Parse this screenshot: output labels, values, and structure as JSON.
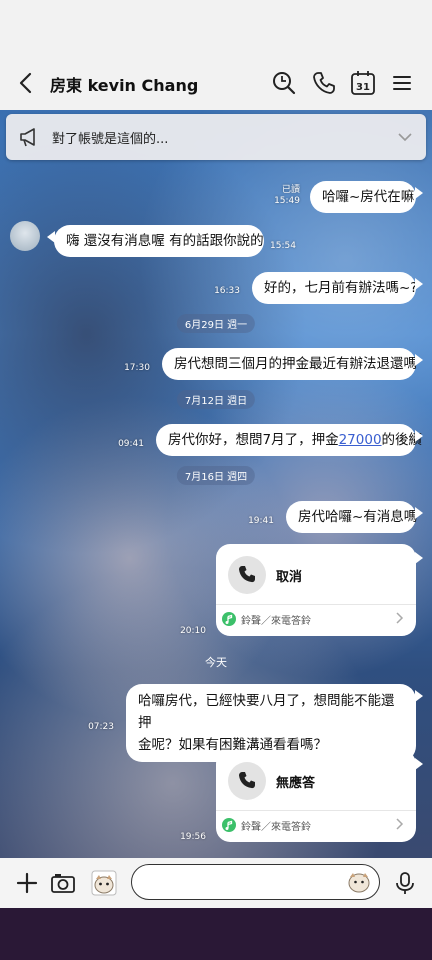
{
  "header": {
    "title": "房東 kevin Chang",
    "calendar_day": "31"
  },
  "notice": {
    "text": "對了帳號是這個的..."
  },
  "messages": [
    {
      "side": "out",
      "text": "哈囉~房代在嘛",
      "read": "已讀",
      "time": "15:49"
    },
    {
      "side": "in",
      "text": "嗨 還沒有消息喔 有的話跟你說的",
      "time": "15:54"
    },
    {
      "side": "out",
      "text": "好的，七月前有辦法嗎~?",
      "time": "16:33"
    },
    {
      "side": "out",
      "text": "房代想問三個月的押金最近有辦法退還嗎",
      "time": "17:30"
    },
    {
      "side": "out",
      "text_before": "房代你好，想問7月了，押金",
      "link": "27000",
      "text_after": "的後續",
      "time": "09:41"
    },
    {
      "side": "out",
      "text": "房代哈囉~有消息嗎",
      "time": "19:41"
    },
    {
      "side": "out",
      "line1": "哈囉房代，已經快要八月了，想問能不能還押",
      "line2": "金呢？如果有困難溝通看看嗎？",
      "time": "07:23"
    }
  ],
  "dates": [
    "6月29日 週一",
    "7月12日 週日",
    "7月16日 週四",
    "今天"
  ],
  "calls": [
    {
      "title": "取消",
      "ring": "鈴聲／來電答鈴",
      "time": "20:10"
    },
    {
      "title": "無應答",
      "ring": "鈴聲／來電答鈴",
      "time": "19:56"
    }
  ],
  "colors": {
    "link": "#3a5fd0",
    "ring_green": "#3cc06a"
  }
}
